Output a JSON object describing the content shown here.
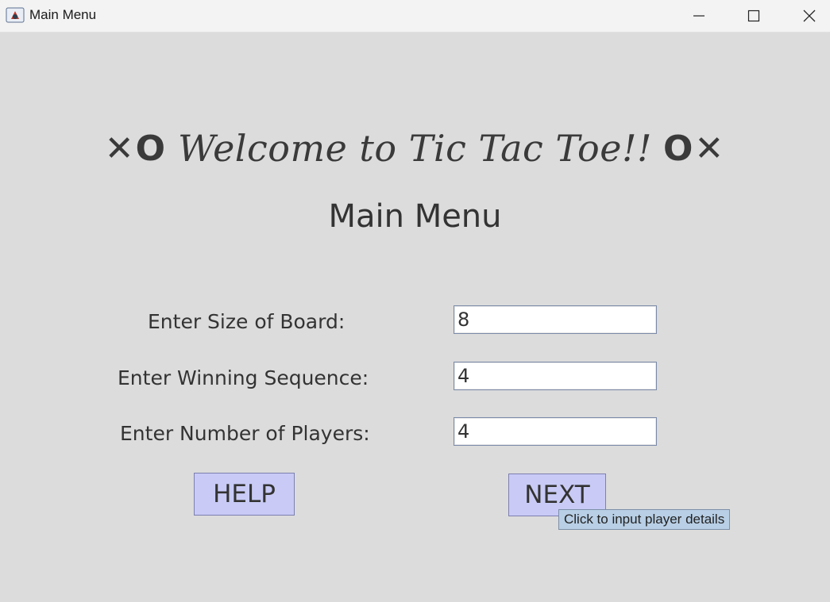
{
  "window": {
    "title": "Main Menu",
    "controls": [
      "minimize-icon",
      "maximize-icon",
      "close-icon"
    ]
  },
  "header": {
    "welcome_left_marks": "✕O",
    "welcome_text": "Welcome to Tic Tac Toe!!",
    "welcome_right_marks": "O✕",
    "subtitle": "Main Menu"
  },
  "form": {
    "board_size": {
      "label": "Enter Size of Board:",
      "value": "8"
    },
    "winning_sequence": {
      "label": "Enter Winning Sequence:",
      "value": "4"
    },
    "num_players": {
      "label": "Enter Number of Players:",
      "value": "4"
    }
  },
  "buttons": {
    "help_label": "HELP",
    "next_label": "NEXT"
  },
  "tooltip": {
    "text": "Click to input player details"
  },
  "colors": {
    "background": "#dcdcdc",
    "button_fill": "#c9cbf6",
    "tooltip_fill": "#b8cfe5"
  }
}
